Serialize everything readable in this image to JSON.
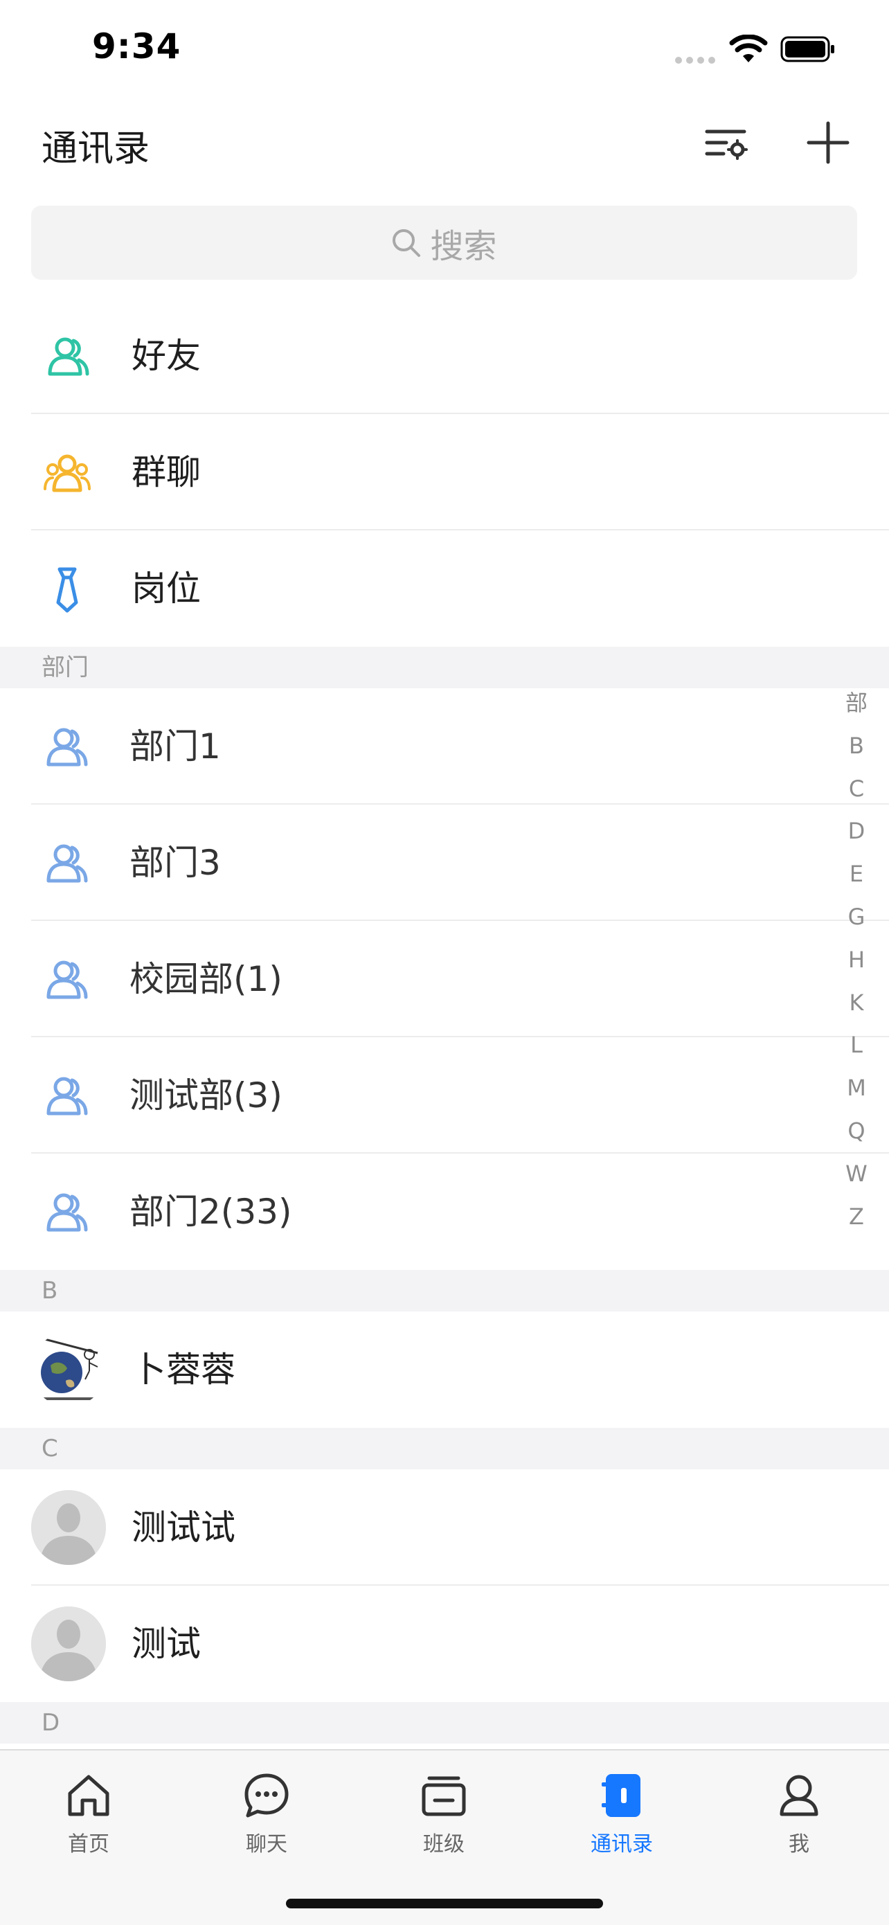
{
  "status": {
    "time": "9:34"
  },
  "header": {
    "title": "通讯录"
  },
  "search": {
    "placeholder": "搜索"
  },
  "quick_items": [
    {
      "label": "好友",
      "icon": "friends-icon",
      "color": "#2ec4a5"
    },
    {
      "label": "群聊",
      "icon": "group-chat-icon",
      "color": "#f5b52e"
    },
    {
      "label": "岗位",
      "icon": "tie-icon",
      "color": "#3a8ee6"
    }
  ],
  "sections": {
    "department": "部门",
    "b": "B",
    "c": "C",
    "d": "D"
  },
  "departments": [
    {
      "label": "部门1"
    },
    {
      "label": "部门3"
    },
    {
      "label": "校园部(1)"
    },
    {
      "label": "测试部(3)"
    },
    {
      "label": "部门2(33)"
    }
  ],
  "contacts_b": [
    {
      "name": "卜蓉蓉"
    }
  ],
  "contacts_c": [
    {
      "name": "测试试"
    },
    {
      "name": "测试"
    }
  ],
  "index": [
    "部",
    "B",
    "C",
    "D",
    "E",
    "G",
    "H",
    "K",
    "L",
    "M",
    "Q",
    "W",
    "Z"
  ],
  "tabs": [
    {
      "label": "首页",
      "icon": "home-icon"
    },
    {
      "label": "聊天",
      "icon": "chat-icon"
    },
    {
      "label": "班级",
      "icon": "class-icon"
    },
    {
      "label": "通讯录",
      "icon": "contacts-icon",
      "active": true
    },
    {
      "label": "我",
      "icon": "profile-icon"
    }
  ],
  "colors": {
    "accent": "#1677ff",
    "dept_icon": "#7aa7e6"
  }
}
